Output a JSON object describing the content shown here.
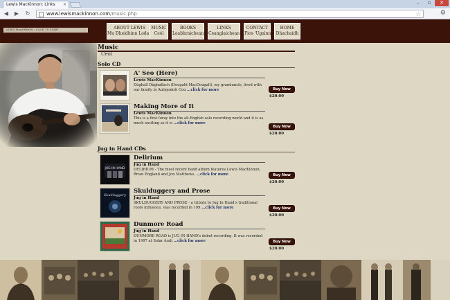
{
  "browser": {
    "tab_title": "Lewis MacKinnon: Links",
    "tab_close": "×",
    "url_domain": "www.lewismackinnon.com",
    "url_path": "/music.php",
    "back_icon": "◀",
    "forward_icon": "▶",
    "reload_icon": "↻",
    "star_icon": "☆",
    "wrench_icon": "⚙",
    "win_min": "–",
    "win_max": "▫",
    "win_close": "✕"
  },
  "site": {
    "logo_text": "LEWIS MacKINNON  ·  CLICK TO START  ·",
    "nav": [
      {
        "en": "ABOUT LEWIS",
        "gd": "Mu Dheidhinn Lodaidh"
      },
      {
        "en": "MUSIC",
        "gd": "Ceòl"
      },
      {
        "en": "BOOKS",
        "gd": "Leabhraichean"
      },
      {
        "en": "LINKS",
        "gd": "Ceanglaichean"
      },
      {
        "en": "CONTACT",
        "gd": "Fios 'Ugainn"
      },
      {
        "en": "HOME",
        "gd": "Dhachaidh"
      }
    ]
  },
  "page": {
    "heading": "Music",
    "subheading": "Ceòl",
    "solo_heading": "Solo CD",
    "jug_heading": "Jug in Hand CDs",
    "buy_label": "Buy Now",
    "more_label": "...click for more"
  },
  "solo": [
    {
      "title": "A' Seo (Here)",
      "artist": "Lewis MacKinnon",
      "desc": "Dùghall Dùghallach (Dougald MacDougall), my granduncle, lived with our family in Antigonish Cou",
      "price": "$20.00"
    },
    {
      "title": "Making More of It",
      "artist": "Lewis MacKinnon",
      "desc": "This is a first foray into the all-English solo recording world and it is as much exciting as it is",
      "price": "$20.00"
    }
  ],
  "jug": [
    {
      "title": "Delirium",
      "artist": "Jug in Hand",
      "desc": "DELIRIUM - The most recent band album features Lewis MacKinnon, Brian England and Jon Matthews.",
      "price": "$20.00",
      "cover_text": "JUG IN HAND"
    },
    {
      "title": "Skulduggery and Prose",
      "artist": "Jug in Hand",
      "desc": "SKULDUGGERY AND PROSE - a tribute to Jug In Hand's traditional roots influence, was recorded in 199",
      "price": "$20.00",
      "cover_text": "Skulduggery"
    },
    {
      "title": "Dunmore Road",
      "artist": "Jug in Hand",
      "desc": "DUNMORE ROAD is JUG IN HAND's debut recording. It was recorded in 1997 at Solar Audi",
      "price": "$20.00"
    }
  ]
}
